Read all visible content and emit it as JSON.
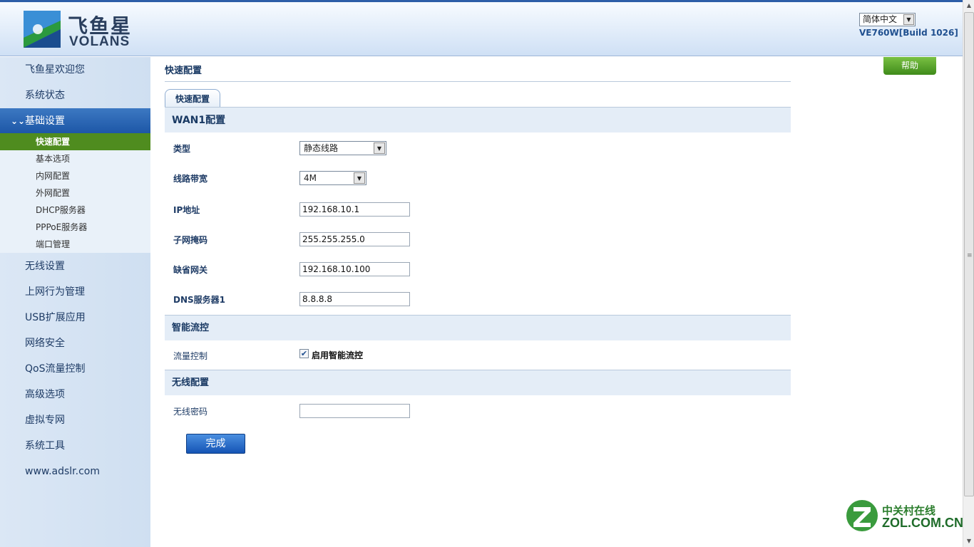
{
  "header": {
    "logo_cn": "飞鱼星",
    "logo_en": "VOLANS",
    "language": "简体中文",
    "version": "VE760W[Build 1026]"
  },
  "sidebar": {
    "items": [
      {
        "label": "飞鱼星欢迎您"
      },
      {
        "label": "系统状态"
      },
      {
        "label": "基础设置"
      },
      {
        "label": "无线设置"
      },
      {
        "label": "上网行为管理"
      },
      {
        "label": "USB扩展应用"
      },
      {
        "label": "网络安全"
      },
      {
        "label": "QoS流量控制"
      },
      {
        "label": "高级选项"
      },
      {
        "label": "虚拟专网"
      },
      {
        "label": "系统工具"
      },
      {
        "label": "www.adslr.com"
      }
    ],
    "sub_items": [
      {
        "label": "快速配置"
      },
      {
        "label": "基本选项"
      },
      {
        "label": "内网配置"
      },
      {
        "label": "外网配置"
      },
      {
        "label": "DHCP服务器"
      },
      {
        "label": "PPPoE服务器"
      },
      {
        "label": "端口管理"
      }
    ]
  },
  "main": {
    "title": "快速配置",
    "help_label": "帮助",
    "tab_label": "快速配置",
    "wan_section": {
      "title": "WAN1配置",
      "type_label": "类型",
      "type_value": "静态线路",
      "bandwidth_label": "线路带宽",
      "bandwidth_value": "4M",
      "ip_label": "IP地址",
      "ip_value": "192.168.10.1",
      "mask_label": "子网掩码",
      "mask_value": "255.255.255.0",
      "gateway_label": "缺省网关",
      "gateway_value": "192.168.10.100",
      "dns_label": "DNS服务器1",
      "dns_value": "8.8.8.8"
    },
    "flow_section": {
      "title": "智能流控",
      "label": "流量控制",
      "checkbox_label": "启用智能流控",
      "checked": true
    },
    "wireless_section": {
      "title": "无线配置",
      "password_label": "无线密码",
      "password_value": ""
    },
    "done_label": "完成"
  },
  "watermark": {
    "cn": "中关村在线",
    "en": "ZOL.COM.CN"
  },
  "colors": {
    "nav_active": "#2a63b0",
    "sub_active": "#4f8c1f",
    "help_button": "#5aa22e",
    "done_button": "#2a6dc8"
  }
}
